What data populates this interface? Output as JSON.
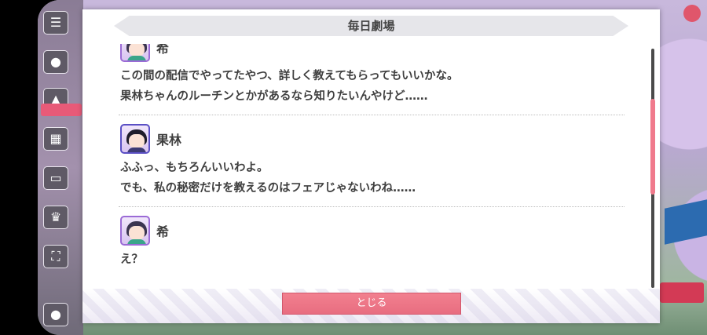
{
  "dialog": {
    "title": "毎日劇場",
    "close_label": "とじる",
    "messages": [
      {
        "speaker": "希",
        "avatar": "nozomi-avatar",
        "lines": [
          "この間の配信でやってたやつ、詳しく教えてもらってもいいかな。",
          "果林ちゃんのルーチンとかがあるなら知りたいんやけど……"
        ]
      },
      {
        "speaker": "果林",
        "avatar": "karin-avatar",
        "lines": [
          "ふふっ、もちろんいいわよ。",
          "でも、私の秘密だけを教えるのはフェアじゃないわね……"
        ]
      },
      {
        "speaker": "希",
        "avatar": "nozomi-avatar",
        "lines": [
          "え？"
        ]
      }
    ],
    "scroll_position": 0.2
  },
  "colors": {
    "accent": "#e86d80",
    "title_bar": "#e6e6ea",
    "text": "#3f3f3f"
  }
}
